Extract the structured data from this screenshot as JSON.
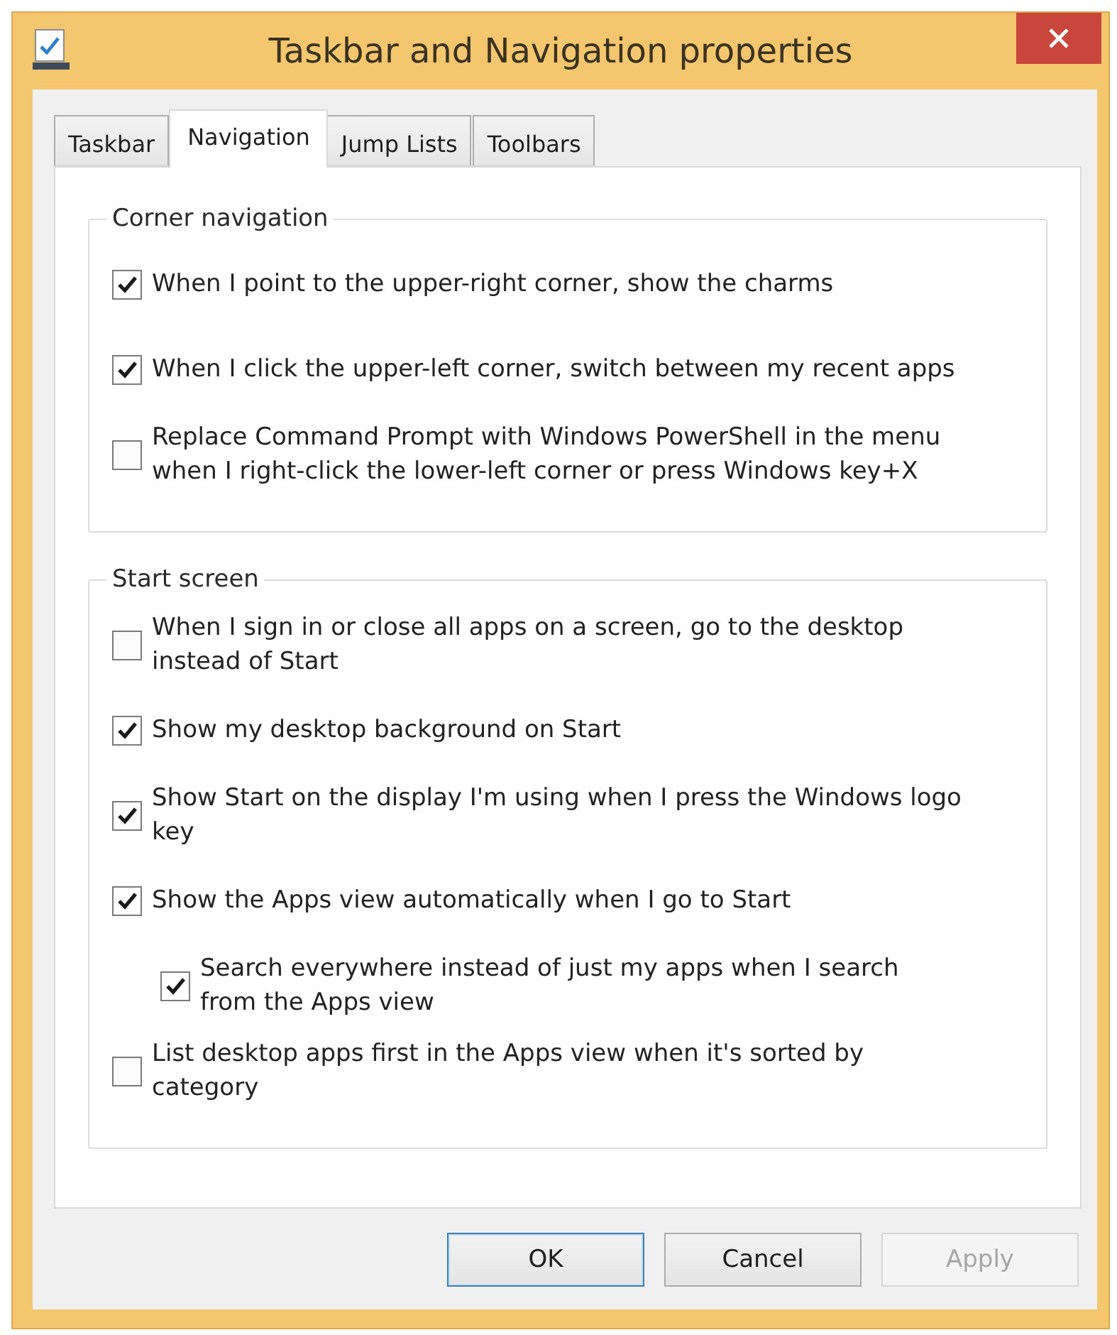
{
  "window": {
    "title": "Taskbar and Navigation properties"
  },
  "tabs": [
    {
      "label": "Taskbar",
      "selected": false
    },
    {
      "label": "Navigation",
      "selected": true
    },
    {
      "label": "Jump Lists",
      "selected": false
    },
    {
      "label": "Toolbars",
      "selected": false
    }
  ],
  "groups": [
    {
      "title": "Corner navigation",
      "options": [
        {
          "label": "When I point to the upper-right corner, show the charms",
          "checked": true
        },
        {
          "label": "When I click the upper-left corner, switch between my recent apps",
          "checked": true
        },
        {
          "label": "Replace Command Prompt with Windows PowerShell in the menu when I right-click the lower-left corner or press Windows key+X",
          "checked": false
        }
      ]
    },
    {
      "title": "Start screen",
      "options": [
        {
          "label": "When I sign in or close all apps on a screen, go to the desktop instead of Start",
          "checked": false
        },
        {
          "label": "Show my desktop background on Start",
          "checked": true
        },
        {
          "label": "Show Start on the display I'm using when I press the Windows logo key",
          "checked": true
        },
        {
          "label": "Show the Apps view automatically when I go to Start",
          "checked": true,
          "children": [
            {
              "label": "Search everywhere instead of just my apps when I search from the Apps view",
              "checked": true
            }
          ]
        },
        {
          "label": "List desktop apps first in the Apps view when it's sorted by category",
          "checked": false
        }
      ]
    }
  ],
  "buttons": [
    {
      "label": "OK",
      "default": true,
      "disabled": false
    },
    {
      "label": "Cancel",
      "default": false,
      "disabled": false
    },
    {
      "label": "Apply",
      "default": false,
      "disabled": true
    }
  ]
}
